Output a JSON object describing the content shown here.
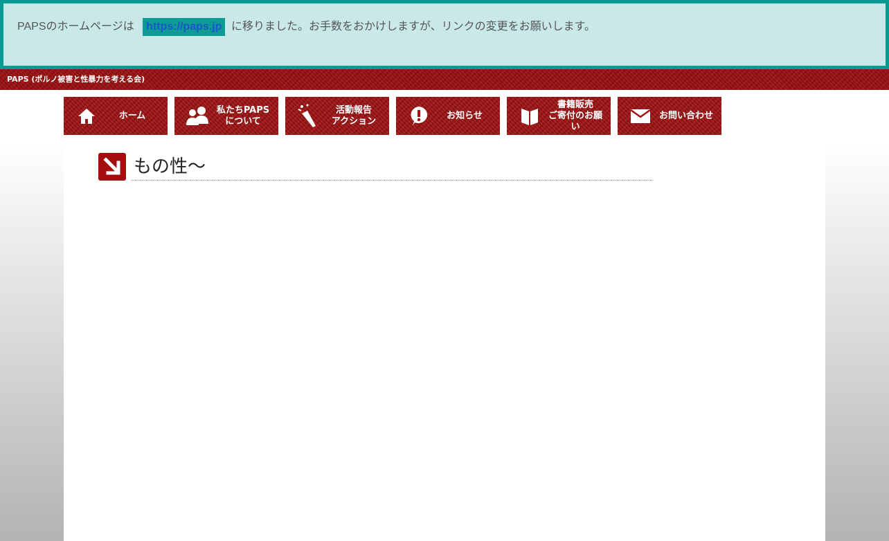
{
  "notice": {
    "text_before": "PAPSのホームページは",
    "link": "https://paps.jp",
    "text_after": "に移りました。お手数をおかけしますが、リンクの変更をお願いします。"
  },
  "site_title": "PAPS (ポルノ被害と性暴力を考える会)",
  "nav": {
    "items": [
      {
        "label": "ホーム",
        "icon": "home-icon"
      },
      {
        "label": "私たちPAPS\nについて",
        "icon": "people-icon"
      },
      {
        "label": "活動報告\nアクション",
        "icon": "party-popper-icon"
      },
      {
        "label": "お知らせ",
        "icon": "exclamation-icon"
      },
      {
        "label": "書籍販売\nご寄付のお願い",
        "icon": "book-icon"
      },
      {
        "label": "お問い合わせ",
        "icon": "mail-icon"
      }
    ]
  },
  "page": {
    "title": "もの性～"
  },
  "colors": {
    "notice_bg": "#c8e9e8",
    "notice_border": "#0a9a94",
    "brand_red": "#a01212",
    "link_bg": "#0d9c94",
    "link_text": "#1a57c8"
  }
}
